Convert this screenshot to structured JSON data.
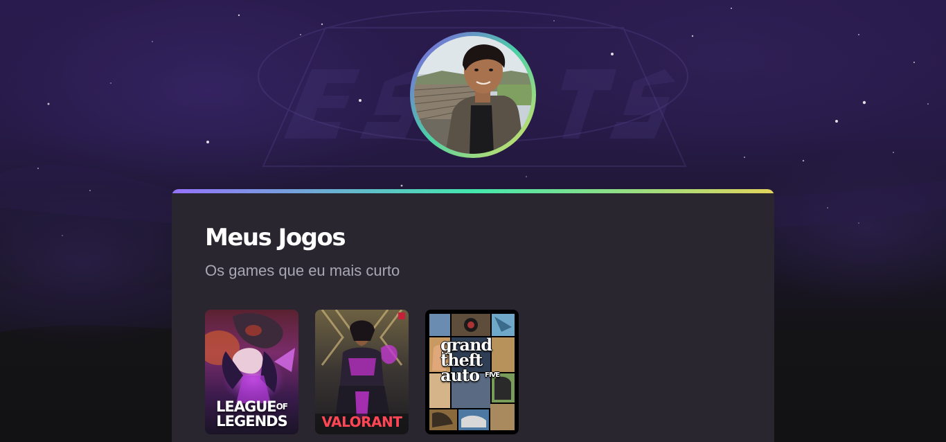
{
  "profile": {
    "avatar_alt": "Foto de perfil"
  },
  "section": {
    "title": "Meus Jogos",
    "subtitle": "Os games que eu mais curto"
  },
  "games": [
    {
      "logo_line1": "LEAGUE",
      "logo_of": "OF",
      "logo_line2": "LEGENDS"
    },
    {
      "logo": "VALORANT"
    },
    {
      "logo_line1": "grand",
      "logo_line2": "theft",
      "logo_line3": "auto",
      "logo_five": "FIVE"
    }
  ],
  "background": {
    "watermark": "ESPORTS"
  },
  "colors": {
    "accent_purple": "#8257e5",
    "accent_green": "#43e7ad",
    "accent_yellow": "#e2d45c",
    "card_bg": "#29262f",
    "text_muted": "#a8a8b3"
  }
}
